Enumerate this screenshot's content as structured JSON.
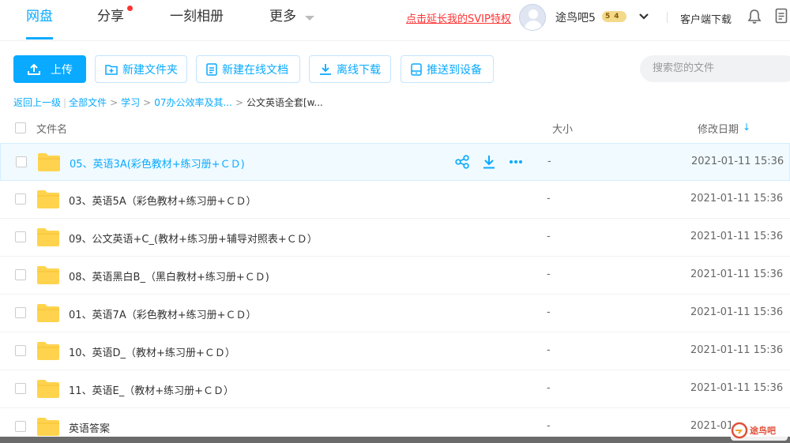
{
  "nav": {
    "tabs": [
      {
        "label": "网盘",
        "active": true
      },
      {
        "label": "分享",
        "has_badge": true
      },
      {
        "label": "一刻相册"
      },
      {
        "label": "更多"
      }
    ],
    "svip_link": "点击延长我的SVIP特权",
    "username": "途鸟吧5",
    "level_badge": "54",
    "client_download": "客户端下载",
    "icons": [
      "bell-icon",
      "document-icon"
    ]
  },
  "toolbar": {
    "upload": "上传",
    "new_folder": "新建文件夹",
    "new_online_doc": "新建在线文档",
    "offline_download": "离线下载",
    "push_to_device": "推送到设备",
    "search_placeholder": "搜索您的文件"
  },
  "breadcrumb": {
    "back": "返回上一级",
    "items": [
      "全部文件",
      "学习",
      "07办公效率及其..."
    ],
    "current": "公文英语全套[w..."
  },
  "table": {
    "headers": {
      "name": "文件名",
      "size": "大小",
      "modified": "修改日期"
    },
    "sort": "modified-desc",
    "rows": [
      {
        "name": "05、英语3A(彩色教材+练习册+ＣＤ)",
        "size": "-",
        "modified": "2021-01-11 15:36",
        "highlighted": true
      },
      {
        "name": "03、英语5A（彩色教材+练习册+ＣＤ）",
        "size": "-",
        "modified": "2021-01-11 15:36"
      },
      {
        "name": "09、公文英语+C_(教材+练习册+辅导对照表+ＣＤ）",
        "size": "-",
        "modified": "2021-01-11 15:36"
      },
      {
        "name": "08、英语黑白B_（黑白教材+练习册+ＣＤ)",
        "size": "-",
        "modified": "2021-01-11 15:36"
      },
      {
        "name": "01、英语7A（彩色教材+练习册+ＣＤ）",
        "size": "-",
        "modified": "2021-01-11 15:36"
      },
      {
        "name": "10、英语D_（教材+练习册+ＣＤ）",
        "size": "-",
        "modified": "2021-01-11 15:36"
      },
      {
        "name": "11、英语E_（教材+练习册+ＣＤ）",
        "size": "-",
        "modified": "2021-01-11 15:36"
      },
      {
        "name": "英语答案",
        "size": "-",
        "modified": "2021-01-"
      }
    ]
  },
  "watermark": "途鸟吧",
  "colors": {
    "accent": "#09aaff",
    "folder": "#ffd34e",
    "alert": "#ff3333"
  }
}
